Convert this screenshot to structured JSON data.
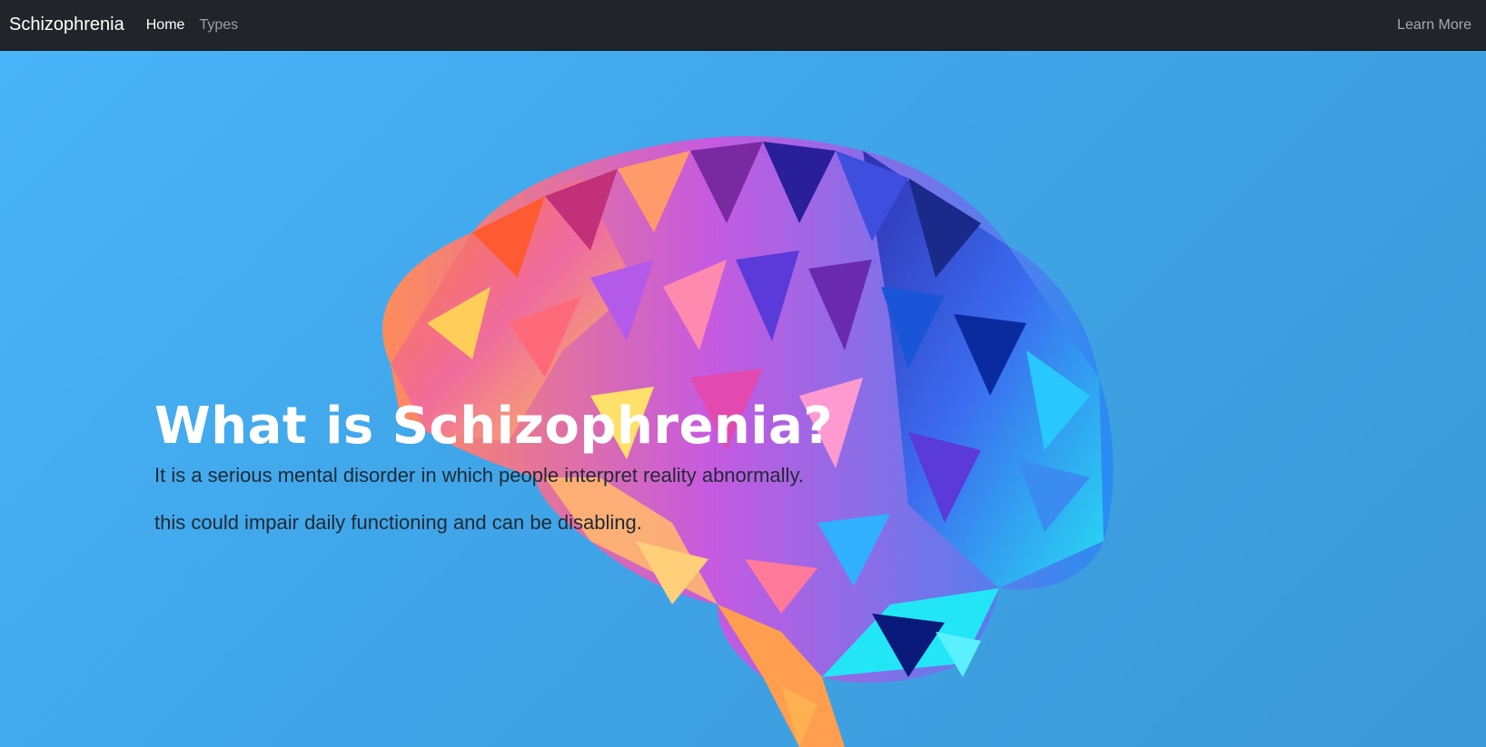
{
  "navbar": {
    "brand": "Schizophrenia",
    "links": [
      {
        "label": "Home",
        "active": true
      },
      {
        "label": "Types",
        "active": false
      }
    ],
    "right_link": "Learn More"
  },
  "hero": {
    "title": "What is Schizophrenia?",
    "line1": "It is a serious mental disorder in which people interpret reality abnormally.",
    "line2": "this could impair daily functioning and can be disabling.",
    "image": "low-poly-brain-illustration"
  },
  "colors": {
    "navbar_bg": "#212529",
    "hero_bg": "#42a8ec"
  }
}
